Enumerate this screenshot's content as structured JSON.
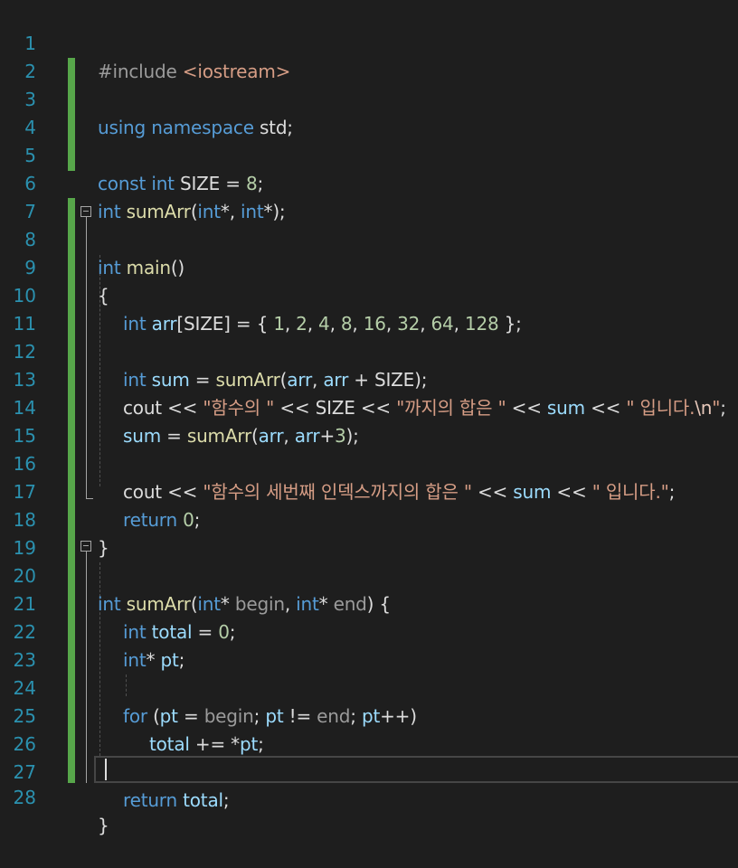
{
  "editor": {
    "line_numbers": [
      "1",
      "2",
      "3",
      "4",
      "5",
      "6",
      "7",
      "8",
      "9",
      "10",
      "11",
      "12",
      "13",
      "14",
      "15",
      "16",
      "17",
      "18",
      "19",
      "20",
      "21",
      "22",
      "23",
      "24",
      "25",
      "26",
      "27",
      "28"
    ],
    "tokens": {
      "l1": [
        "#include ",
        "<iostream>"
      ],
      "l3": [
        "using",
        " ",
        "namespace",
        " std;"
      ],
      "l5": [
        "const",
        " ",
        "int",
        " SIZE = ",
        "8",
        ";"
      ],
      "l6": [
        "int",
        " ",
        "sumArr",
        "(",
        "int",
        "*, ",
        "int",
        "*);"
      ],
      "l8": [
        "int",
        " ",
        "main",
        "()"
      ],
      "l9": [
        "{"
      ],
      "l10": [
        "int",
        " ",
        "arr",
        "[SIZE] = { ",
        "1",
        ", ",
        "2",
        ", ",
        "4",
        ", ",
        "8",
        ", ",
        "16",
        ", ",
        "32",
        ", ",
        "64",
        ", ",
        "128",
        " };"
      ],
      "l12": [
        "int",
        " ",
        "sum",
        " = ",
        "sumArr",
        "(",
        "arr",
        ", ",
        "arr",
        " + SIZE);"
      ],
      "l13": [
        "cout << ",
        "\"함수의 \"",
        " << SIZE << ",
        "\"까지의 합은 \"",
        " << ",
        "sum",
        " << ",
        "\" 입니다.",
        "\\n",
        "\"",
        ";"
      ],
      "l14": [
        "sum",
        " = ",
        "sumArr",
        "(",
        "arr",
        ", ",
        "arr",
        "+",
        "3",
        ");"
      ],
      "l16": [
        "cout << ",
        "\"함수의 세번째 인덱스까지의 합은 \"",
        " << ",
        "sum",
        " << ",
        "\" 입니다.\"",
        ";"
      ],
      "l17": [
        "return",
        " ",
        "0",
        ";"
      ],
      "l18": [
        "}"
      ],
      "l20": [
        "int",
        " ",
        "sumArr",
        "(",
        "int",
        "* ",
        "begin",
        ", ",
        "int",
        "* ",
        "end",
        ") {"
      ],
      "l21": [
        "int",
        " ",
        "total",
        " = ",
        "0",
        ";"
      ],
      "l22": [
        "int",
        "* ",
        "pt",
        ";"
      ],
      "l24": [
        "for",
        " (",
        "pt",
        " = ",
        "begin",
        "; ",
        "pt",
        " != ",
        "end",
        "; ",
        "pt",
        "++)"
      ],
      "l25": [
        "total",
        " += *",
        "pt",
        ";"
      ],
      "l27": [
        "return",
        " ",
        "total",
        ";"
      ],
      "l28": [
        "}"
      ]
    }
  },
  "colors": {
    "background": "#1e1e1e",
    "line_number": "#2b91af",
    "keyword": "#569cd6",
    "function": "#dcdcaa",
    "string": "#d69d85",
    "number": "#b5cea8",
    "variable": "#9cdcfe",
    "change_bar": "#57a64a"
  }
}
